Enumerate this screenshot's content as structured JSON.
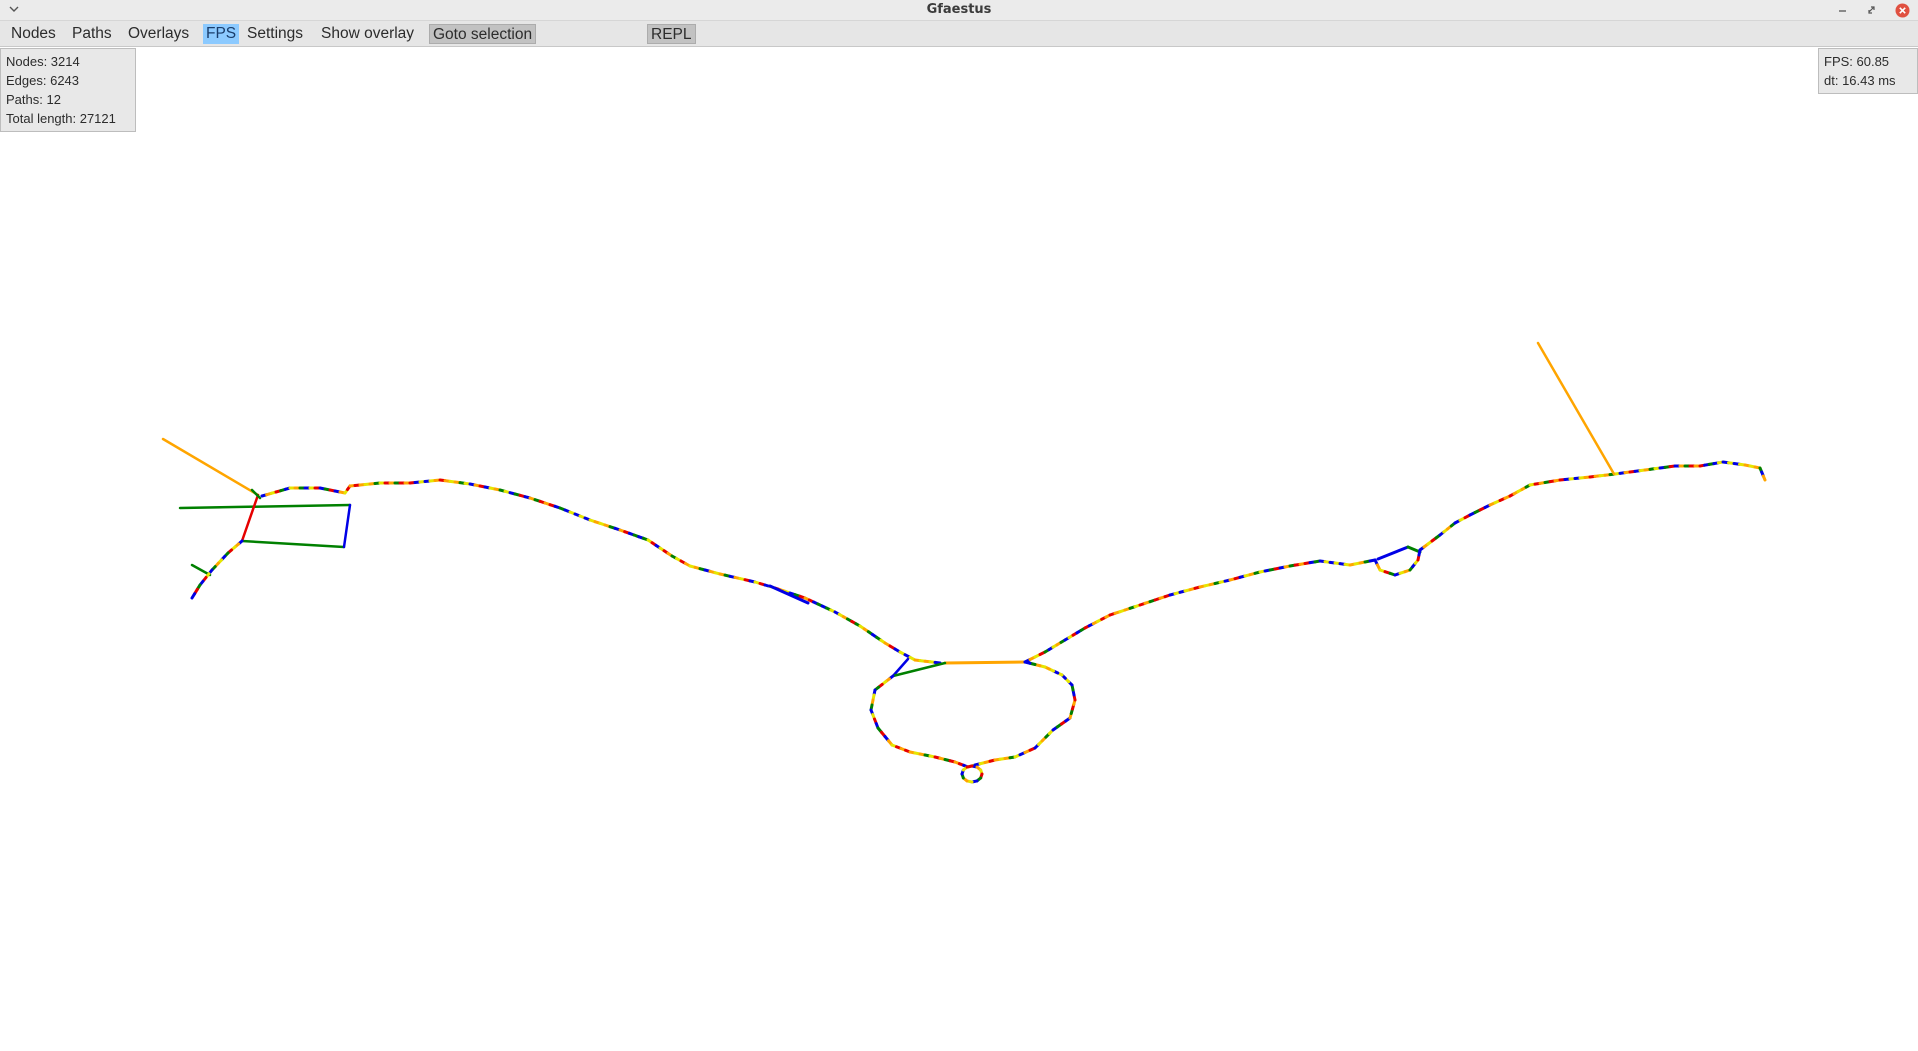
{
  "window": {
    "title": "Gfaestus"
  },
  "menubar": {
    "items": [
      {
        "id": "nodes",
        "label": "Nodes",
        "state": "normal"
      },
      {
        "id": "paths",
        "label": "Paths",
        "state": "normal"
      },
      {
        "id": "overlays",
        "label": "Overlays",
        "state": "normal"
      },
      {
        "id": "fps",
        "label": "FPS",
        "state": "active"
      },
      {
        "id": "settings",
        "label": "Settings",
        "state": "normal"
      },
      {
        "id": "show-overlay",
        "label": "Show overlay",
        "state": "normal"
      },
      {
        "id": "goto-selection",
        "label": "Goto selection",
        "state": "pressed"
      },
      {
        "id": "repl",
        "label": "REPL",
        "state": "pressed"
      }
    ]
  },
  "stats": {
    "nodes": "Nodes: 3214",
    "edges": "Edges: 6243",
    "paths": "Paths: 12",
    "total_length": "Total length: 27121"
  },
  "fps_panel": {
    "fps": "FPS: 60.85",
    "dt": "dt:  16.43 ms"
  },
  "colors": {
    "node_palette": [
      "#e60000",
      "#0000e6",
      "#ffa500",
      "#008000",
      "#e6e600"
    ],
    "accent": "#8ccaff",
    "close_button": "#e05040"
  },
  "icons": {
    "window_menu": "chevron-down-icon",
    "minimize": "minimize-icon",
    "restore": "restore-icon",
    "close": "close-icon"
  }
}
